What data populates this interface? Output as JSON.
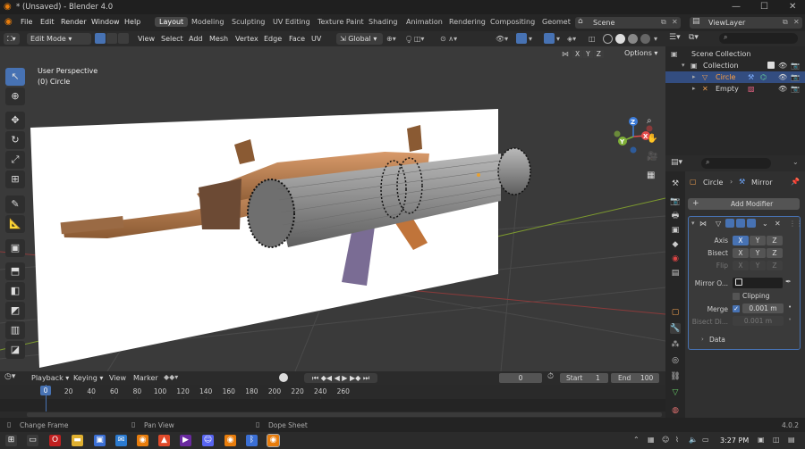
{
  "window": {
    "title": "* (Unsaved) - Blender 4.0"
  },
  "menu": [
    "File",
    "Edit",
    "Render",
    "Window",
    "Help"
  ],
  "workspaces": [
    "Layout",
    "Modeling",
    "Sculpting",
    "UV Editing",
    "Texture Paint",
    "Shading",
    "Animation",
    "Rendering",
    "Compositing",
    "Geomet"
  ],
  "scene": {
    "name": "Scene"
  },
  "view_layer": {
    "name": "ViewLayer"
  },
  "header3d": {
    "mode": "Edit Mode",
    "menus": [
      "View",
      "Select",
      "Add",
      "Mesh",
      "Vertex",
      "Edge",
      "Face",
      "UV"
    ],
    "orientation": "Global",
    "options": "Options",
    "axes": [
      "X",
      "Y",
      "Z"
    ]
  },
  "viewport": {
    "perspective": "User Perspective",
    "object": "(0) Circle"
  },
  "gizmo": {
    "x": "X",
    "y": "Y",
    "z": "Z"
  },
  "outliner": {
    "root": "Scene Collection",
    "collection": "Collection",
    "items": [
      "Circle",
      "Empty"
    ]
  },
  "properties": {
    "breadcrumb_object": "Circle",
    "breadcrumb_modifier": "Mirror",
    "add_modifier": "Add Modifier",
    "labels": {
      "axis": "Axis",
      "bisect": "Bisect",
      "flip": "Flip",
      "mirror_object": "Mirror O...",
      "clipping": "Clipping",
      "merge": "Merge",
      "bisect_distance": "Bisect Di...",
      "data": "Data"
    },
    "xyz": [
      "X",
      "Y",
      "Z"
    ],
    "merge_value": "0.001 m",
    "bisect_value": "0.001 m"
  },
  "timeline": {
    "menus": [
      "Playback",
      "Keying",
      "View",
      "Marker"
    ],
    "current": "0",
    "start_label": "Start",
    "start": "1",
    "end_label": "End",
    "end": "100",
    "ticks": [
      "0",
      "20",
      "40",
      "60",
      "80",
      "100",
      "120",
      "140",
      "160",
      "180",
      "200",
      "220",
      "240",
      "260"
    ],
    "frame_marker": "0"
  },
  "status": {
    "a": "Change Frame",
    "b": "Pan View",
    "c": "Dope Sheet",
    "version": "4.0.2"
  },
  "taskbar": {
    "time": "3:27 PM"
  }
}
